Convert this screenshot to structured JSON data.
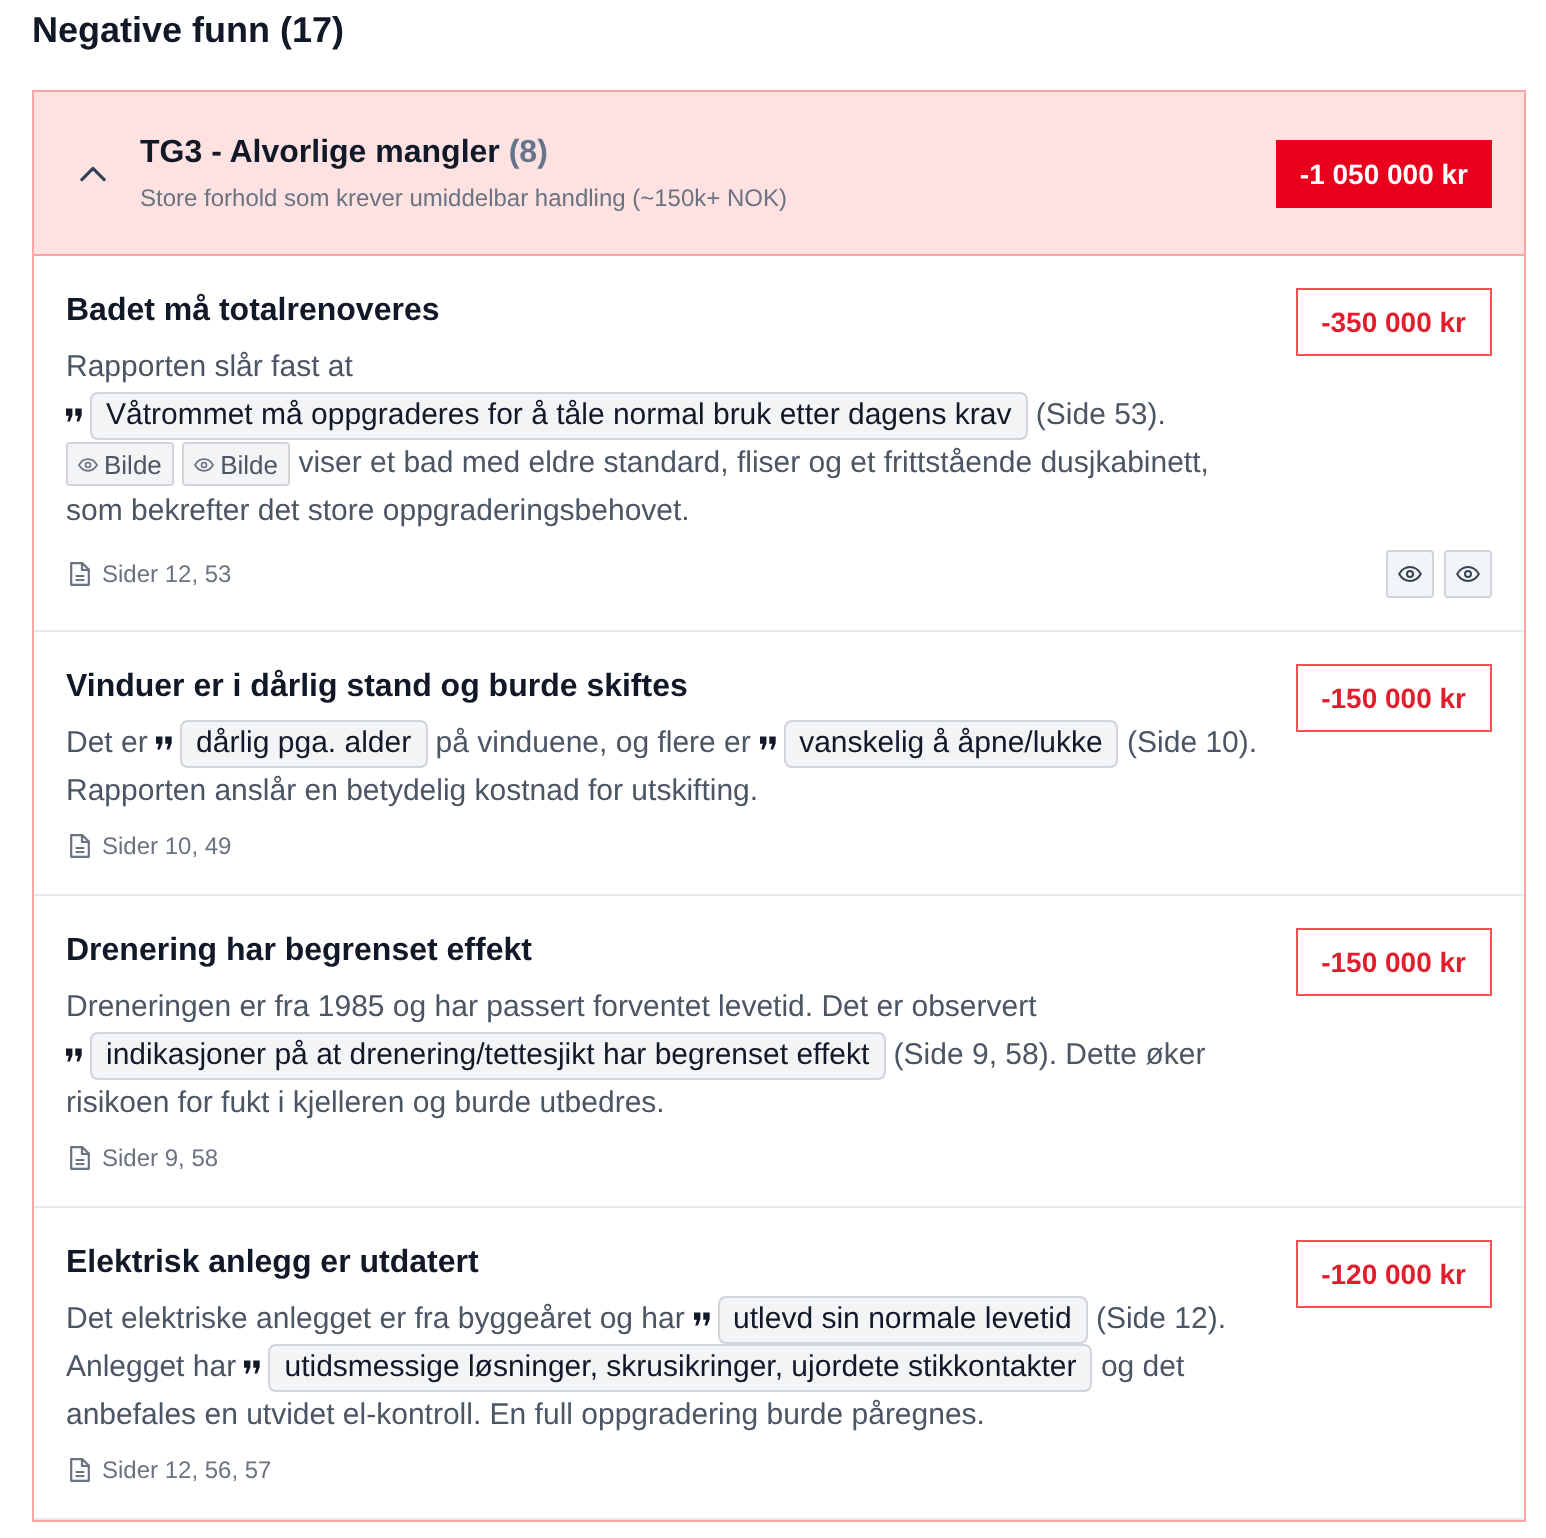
{
  "section_title": "Negative funn (17)",
  "group": {
    "title": "TG3 - Alvorlige mangler",
    "count": "(8)",
    "subtitle": "Store forhold som krever umiddelbar handling (~150k+ NOK)",
    "total": "-1 050 000 kr",
    "expanded": true,
    "findings": [
      {
        "title": "Badet må totalrenoveres",
        "amount": "-350 000 kr",
        "body": [
          {
            "kind": "text",
            "text": "Rapporten slår fast at"
          },
          {
            "kind": "quote",
            "text": "Våtrommet må oppgraderes for å tåle normal bruk etter dagens krav"
          },
          {
            "kind": "text",
            "text": "(Side 53)."
          },
          {
            "kind": "image",
            "text": "Bilde"
          },
          {
            "kind": "image",
            "text": "Bilde"
          },
          {
            "kind": "text",
            "text": "viser et bad med eldre standard, fliser og et frittstående dusjkabinett, som bekrefter det store oppgraderingsbehovet."
          }
        ],
        "pages": "Sider 12, 53",
        "preview_buttons": [
          {
            "kind": "image"
          },
          {
            "kind": "image"
          }
        ]
      },
      {
        "title": "Vinduer er i dårlig stand og burde skiftes",
        "amount": "-150 000 kr",
        "body": [
          {
            "kind": "text",
            "text": "Det er"
          },
          {
            "kind": "quote",
            "text": "dårlig pga. alder"
          },
          {
            "kind": "text",
            "text": "på vinduene, og flere er"
          },
          {
            "kind": "quote",
            "text": "vanskelig å åpne/lukke"
          },
          {
            "kind": "text",
            "text": "(Side 10). Rapporten anslår en betydelig kostnad for utskifting."
          }
        ],
        "pages": "Sider 10, 49"
      },
      {
        "title": "Drenering har begrenset effekt",
        "amount": "-150 000 kr",
        "body": [
          {
            "kind": "text",
            "text": "Dreneringen er fra 1985 og har passert forventet levetid. Det er observert"
          },
          {
            "kind": "quote",
            "text": "indikasjoner på at drenering/tettesjikt har begrenset effekt"
          },
          {
            "kind": "text",
            "text": "(Side 9, 58). Dette øker risikoen for fukt i kjelleren og burde utbedres."
          }
        ],
        "pages": "Sider 9, 58"
      },
      {
        "title": "Elektrisk anlegg er utdatert",
        "amount": "-120 000 kr",
        "body": [
          {
            "kind": "text",
            "text": "Det elektriske anlegget er fra byggeåret og har"
          },
          {
            "kind": "quote",
            "text": "utlevd sin normale levetid"
          },
          {
            "kind": "text",
            "text": "(Side 12). Anlegget har"
          },
          {
            "kind": "quote",
            "text": "utidsmessige løsninger, skrusikringer, ujordete stikkontakter"
          },
          {
            "kind": "text",
            "text": "og det anbefales en utvidet el-kontroll. En full oppgradering burde påregnes."
          }
        ],
        "pages": "Sider 12, 56, 57"
      }
    ]
  }
}
